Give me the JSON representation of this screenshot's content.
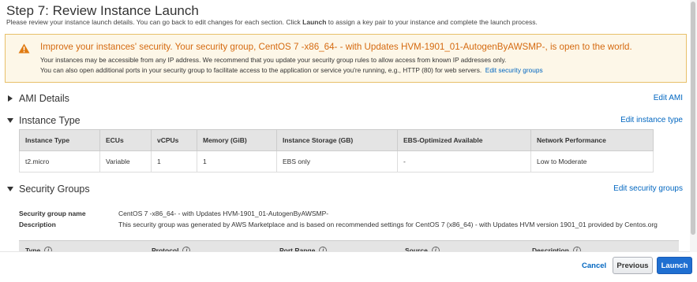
{
  "header": {
    "title": "Step 7: Review Instance Launch",
    "desc_before": "Please review your instance launch details. You can go back to edit changes for each section. Click ",
    "desc_bold": "Launch",
    "desc_after": " to assign a key pair to your instance and complete the launch process."
  },
  "warning": {
    "title": "Improve your instances' security. Your security group, CentOS 7 -x86_64- - with Updates HVM-1901_01-AutogenByAWSMP-, is open to the world.",
    "line1": "Your instances may be accessible from any IP address. We recommend that you update your security group rules to allow access from known IP addresses only.",
    "line2": "You can also open additional ports in your security group to facilitate access to the application or service you're running, e.g., HTTP (80) for web servers.",
    "link": "Edit security groups",
    "color": "#d56a10"
  },
  "sections": {
    "ami": {
      "title": "AMI Details",
      "edit": "Edit AMI"
    },
    "instance": {
      "title": "Instance Type",
      "edit": "Edit instance type"
    },
    "security": {
      "title": "Security Groups",
      "edit": "Edit security groups"
    }
  },
  "instance_table": {
    "headers": [
      "Instance Type",
      "ECUs",
      "vCPUs",
      "Memory (GiB)",
      "Instance Storage (GB)",
      "EBS-Optimized Available",
      "Network Performance"
    ],
    "row": [
      "t2.micro",
      "Variable",
      "1",
      "1",
      "EBS only",
      "-",
      "Low to Moderate"
    ]
  },
  "security_group": {
    "name_label": "Security group name",
    "name_value": "CentOS 7 -x86_64- - with Updates HVM-1901_01-AutogenByAWSMP-",
    "desc_label": "Description",
    "desc_value": "This security group was generated by AWS Marketplace and is based on recommended settings for CentOS 7 (x86_64) - with Updates HVM version 1901_01 provided by Centos.org"
  },
  "rules_headers": [
    "Type",
    "Protocol",
    "Port Range",
    "Source",
    "Description"
  ],
  "footer": {
    "cancel": "Cancel",
    "previous": "Previous",
    "launch": "Launch"
  },
  "colors": {
    "link": "#0066c0",
    "primary_button": "#1f6fd1",
    "warning_border": "#e8c06a"
  }
}
